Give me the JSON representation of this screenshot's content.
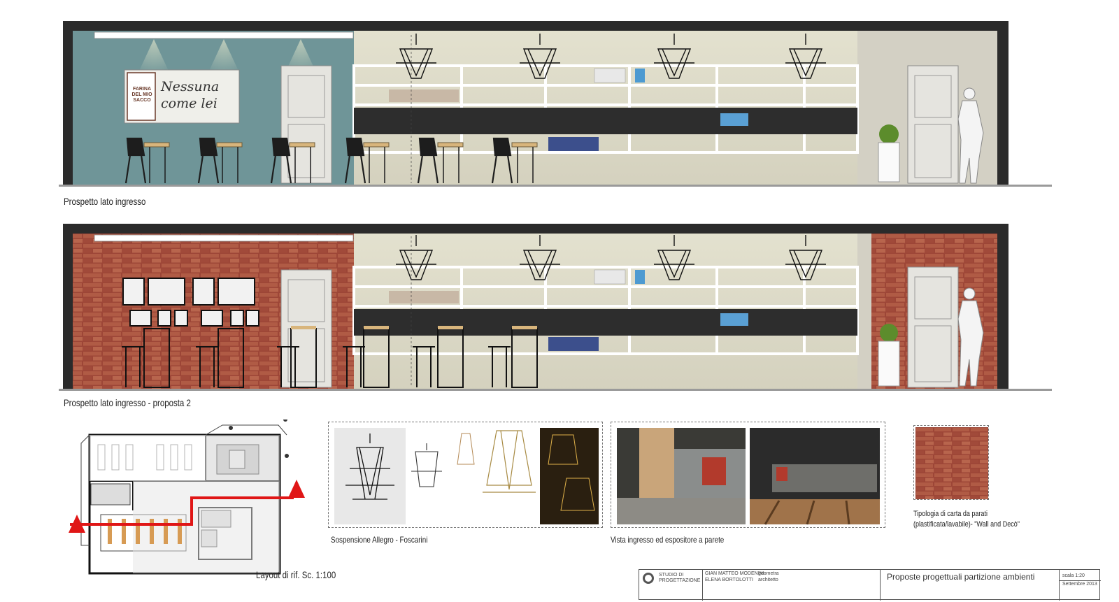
{
  "elevation1": {
    "caption": "Prospetto lato ingresso",
    "sign_brand": "FARINA DEL MIO SACCO",
    "sign_script": "Nessuna come lei"
  },
  "elevation2": {
    "caption": "Prospetto lato ingresso - proposta 2"
  },
  "plan": {
    "caption": "Layout di rif. Sc. 1:100"
  },
  "lamps": {
    "caption": "Sospensione Allegro - Foscarini"
  },
  "views": {
    "caption": "Vista ingresso ed espositore a parete"
  },
  "wallpaper": {
    "caption_line1": "Tipologia di carta da parati",
    "caption_line2": "(plastificata/lavabile)-  \"Wall and Decò\""
  },
  "title_block": {
    "studio_line1": "STUDIO DI",
    "studio_line2": "PROGETTAZIONE",
    "person1": "GIAN MATTEO MODENINI",
    "role1": "geometra",
    "person2": "ELENA BORTOLOTTI",
    "role2": "architetto",
    "title": "Proposte progettuali  partizione ambienti",
    "scale": "scala 1:20",
    "date": "Settembre 2013"
  },
  "colors": {
    "teal_wall": "#6f9598",
    "brick": "#a2483a",
    "dark_frame": "#2b2b2b",
    "plaster": "#d3d0c4",
    "red_arrow": "#e01616"
  }
}
